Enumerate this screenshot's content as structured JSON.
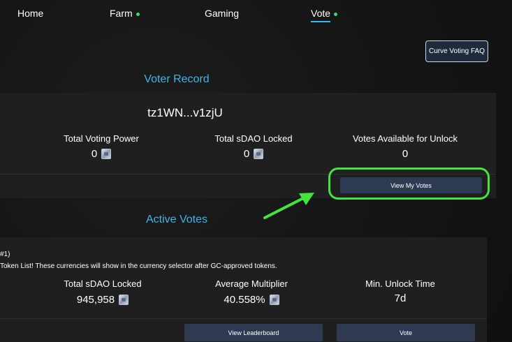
{
  "nav": {
    "home": "Home",
    "farm": "Farm",
    "gaming": "Gaming",
    "vote": "Vote"
  },
  "faq_button": "Curve Voting FAQ",
  "voter_record": {
    "title": "Voter Record",
    "address": "tz1WN...v1zjU",
    "stats": [
      {
        "label": "Total Voting Power",
        "value": "0"
      },
      {
        "label": "Total sDAO Locked",
        "value": "0"
      },
      {
        "label": "Votes Available for Unlock",
        "value": "0"
      }
    ],
    "view_button": "View My Votes"
  },
  "active_votes": {
    "title": "Active Votes",
    "item": {
      "index": "#1)",
      "description": "Token List! These currencies will show in the currency selector after GC-approved tokens.",
      "stats": [
        {
          "label": "Total sDAO Locked",
          "value": "945,958"
        },
        {
          "label": "Average Multiplier",
          "value": "40.558%"
        },
        {
          "label": "Min. Unlock Time",
          "value": "7d"
        }
      ],
      "leaderboard_button": "View Leaderboard",
      "vote_button": "Vote"
    }
  },
  "colors": {
    "accent": "#42b4e8",
    "highlight": "#45e33f",
    "status_dot": "#2ee26f",
    "button": "#2d3a52"
  },
  "icons": [
    "sdao-token-icon",
    "green-arrow-icon"
  ]
}
